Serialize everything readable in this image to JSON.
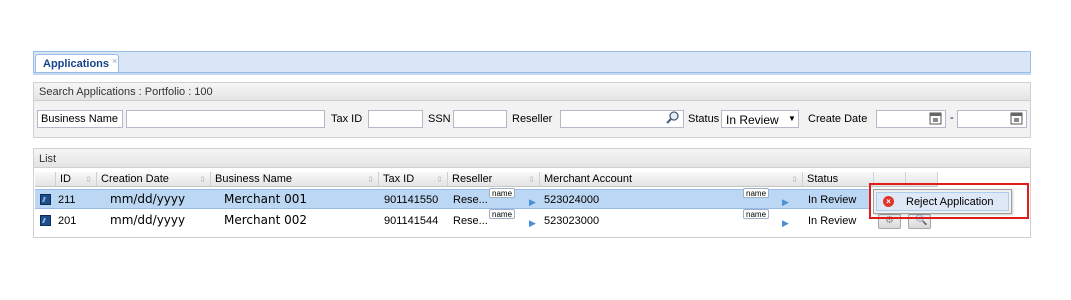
{
  "tabs": [
    {
      "label": "Applications",
      "close": "×"
    }
  ],
  "search": {
    "title": "Search Applications : Portfolio : 100",
    "business_name_label": "Business Name",
    "tax_id_label": "Tax ID",
    "ssn_label": "SSN",
    "reseller_label": "Reseller",
    "status_label": "Status",
    "status_value": "In Review",
    "create_date_label": "Create Date",
    "date_separator": "-"
  },
  "list": {
    "title": "List",
    "columns": [
      "ID",
      "Creation Date",
      "Business Name",
      "Tax ID",
      "Reseller",
      "Merchant Account",
      "Status"
    ],
    "rows": [
      {
        "id": "211",
        "creation_date": "mm/dd/yyyy",
        "business_name": "Merchant 001",
        "tax_id": "901141550",
        "reseller": "Rese...",
        "reseller_tag": "name",
        "merchant_account": "523024000",
        "account_tag": "name",
        "status": "In Review"
      },
      {
        "id": "201",
        "creation_date": "mm/dd/yyyy",
        "business_name": "Merchant 002",
        "tax_id": "901141544",
        "reseller": "Rese...",
        "reseller_tag": "name",
        "merchant_account": "523023000",
        "account_tag": "name",
        "status": "In Review"
      }
    ]
  },
  "context_menu": {
    "items": [
      {
        "label": "Reject Application",
        "icon": "reject-icon"
      }
    ]
  },
  "colors": {
    "selected_row": "#bcd7f3",
    "highlight_border": "#e21b1b",
    "tab_text": "#15428b"
  }
}
